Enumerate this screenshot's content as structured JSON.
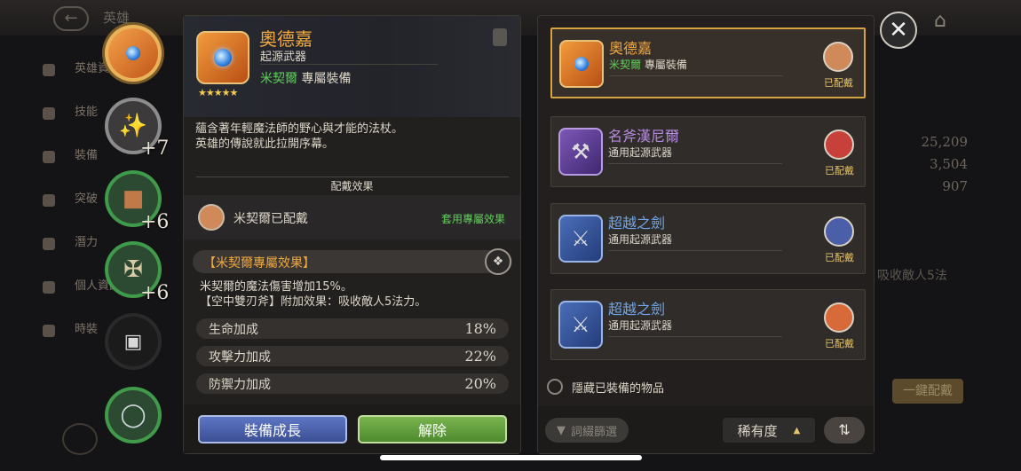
{
  "background": {
    "title": "英雄",
    "menu": [
      "英雄資訊",
      "技能",
      "裝備",
      "突破",
      "潛力",
      "個人資訊",
      "時裝"
    ],
    "stats": [
      "25,209",
      "3,504",
      "907"
    ],
    "partial_text": "吸收敵人5法",
    "button": "一鍵配戴"
  },
  "slots": [
    {
      "icon": "staff-icon",
      "plus": ""
    },
    {
      "icon": "claw-icon",
      "plus": "+7"
    },
    {
      "icon": "armor-icon",
      "plus": "+6"
    },
    {
      "icon": "shield-icon",
      "plus": "+6"
    },
    {
      "icon": "lock-icon",
      "plus": ""
    },
    {
      "icon": "ring-icon",
      "plus": ""
    }
  ],
  "detail": {
    "name": "奧德嘉",
    "type": "起源武器",
    "owner": "米契爾",
    "owner_suffix": "專屬裝備",
    "stars": "★★★★★",
    "description_1": "蘊含著年輕魔法師的野心與才能的法杖。",
    "description_2": "英雄的傳說就此拉開序幕。",
    "equip_effect_title": "配戴效果",
    "equipped_text": "米契爾已配戴",
    "apply_effect": "套用專屬效果",
    "exclusive_title": "【米契爾專屬效果】",
    "effect_line_1": "米契爾的魔法傷害增加15%。",
    "effect_line_2": "【空中雙刃斧】附加效果：吸收敵人5法力。",
    "stats": [
      {
        "label": "生命加成",
        "value": "18%"
      },
      {
        "label": "攻擊力加成",
        "value": "22%"
      },
      {
        "label": "防禦力加成",
        "value": "20%"
      }
    ],
    "grow_button": "裝備成長",
    "remove_button": "解除"
  },
  "list": {
    "items": [
      {
        "name": "奧德嘉",
        "owner": "米契爾",
        "sub": "專屬裝備",
        "status": "已配戴",
        "name_color": "#f0a83f",
        "selected": true
      },
      {
        "name": "名斧漢尼爾",
        "owner": "",
        "sub": "通用起源武器",
        "status": "已配戴",
        "name_color": "#b58ae0",
        "selected": false
      },
      {
        "name": "超越之劍",
        "owner": "",
        "sub": "通用起源武器",
        "status": "已配戴",
        "name_color": "#6fa7ec",
        "selected": false
      },
      {
        "name": "超越之劍",
        "owner": "",
        "sub": "通用起源武器",
        "status": "已配戴",
        "name_color": "#6fa7ec",
        "selected": false
      }
    ],
    "hide_equipped": "隱藏已裝備的物品",
    "filter": "詞綴篩選",
    "sort": "稀有度"
  },
  "colors": {
    "accent_gold": "#d6a33f",
    "green": "#5fcf5a"
  }
}
